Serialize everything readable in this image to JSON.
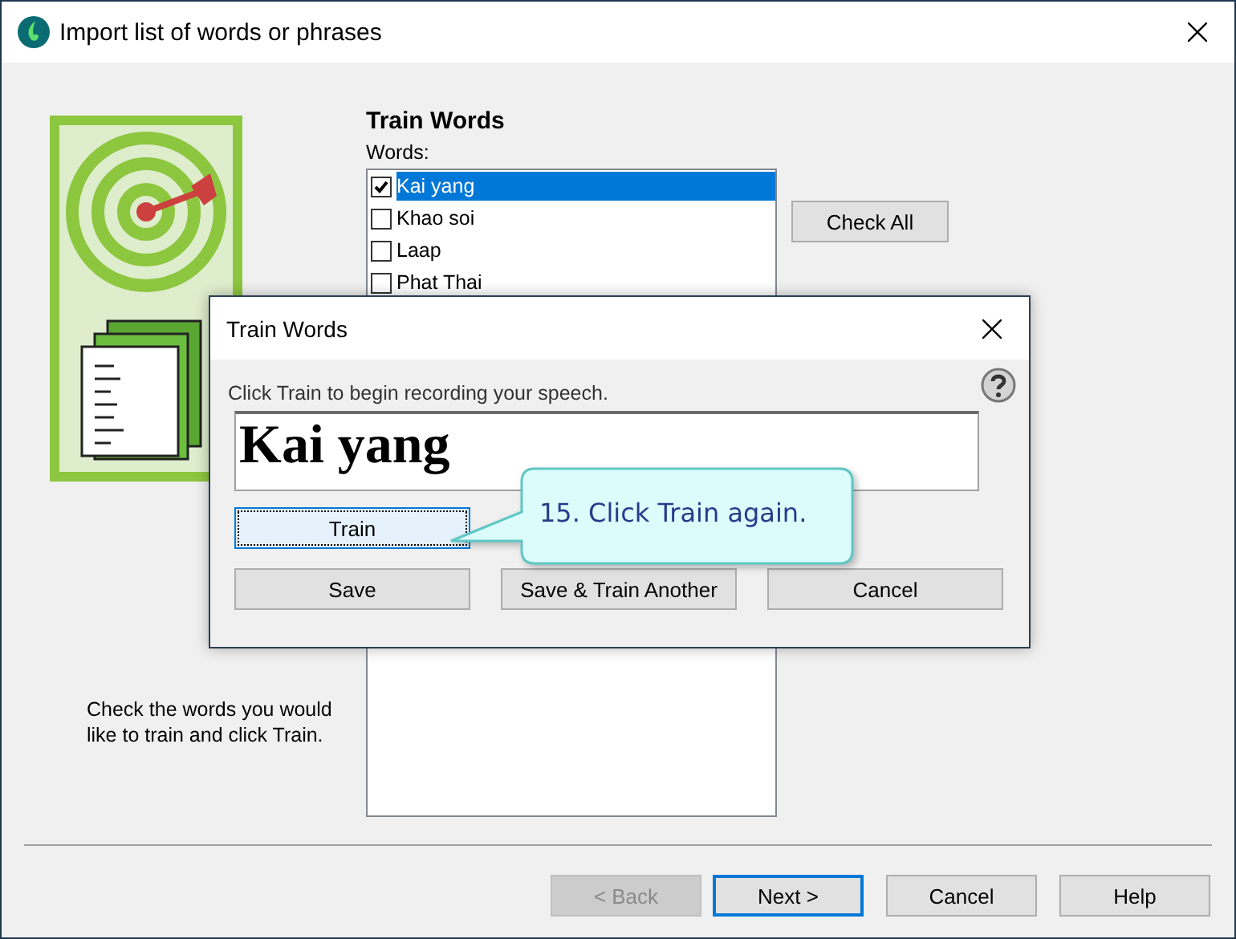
{
  "window": {
    "title": "Import list of words or phrases"
  },
  "page": {
    "title": "Train Words",
    "list_label": "Words:",
    "instructions": "Check the words you would like to train and click Train."
  },
  "words": [
    {
      "label": "Kai yang",
      "checked": true,
      "selected": true
    },
    {
      "label": "Khao soi",
      "checked": false,
      "selected": false
    },
    {
      "label": "Laap",
      "checked": false,
      "selected": false
    },
    {
      "label": "Phat Thai",
      "checked": false,
      "selected": false
    }
  ],
  "check_all": {
    "label": "Check All"
  },
  "footer_buttons": [
    {
      "label": "< Back",
      "disabled": true,
      "default": false
    },
    {
      "label": "Next >",
      "disabled": false,
      "default": true
    },
    {
      "label": "Cancel",
      "disabled": false,
      "default": false
    },
    {
      "label": "Help",
      "disabled": false,
      "default": false
    }
  ],
  "dialog": {
    "title": "Train Words",
    "instruction": "Click Train to begin recording your speech.",
    "word": "Kai yang",
    "train_button": {
      "label": "Train",
      "focused": true
    },
    "buttons": [
      {
        "label": "Save"
      },
      {
        "label": "Save & Train Another"
      },
      {
        "label": "Cancel"
      }
    ]
  },
  "callout": {
    "text": "15. Click Train again."
  }
}
